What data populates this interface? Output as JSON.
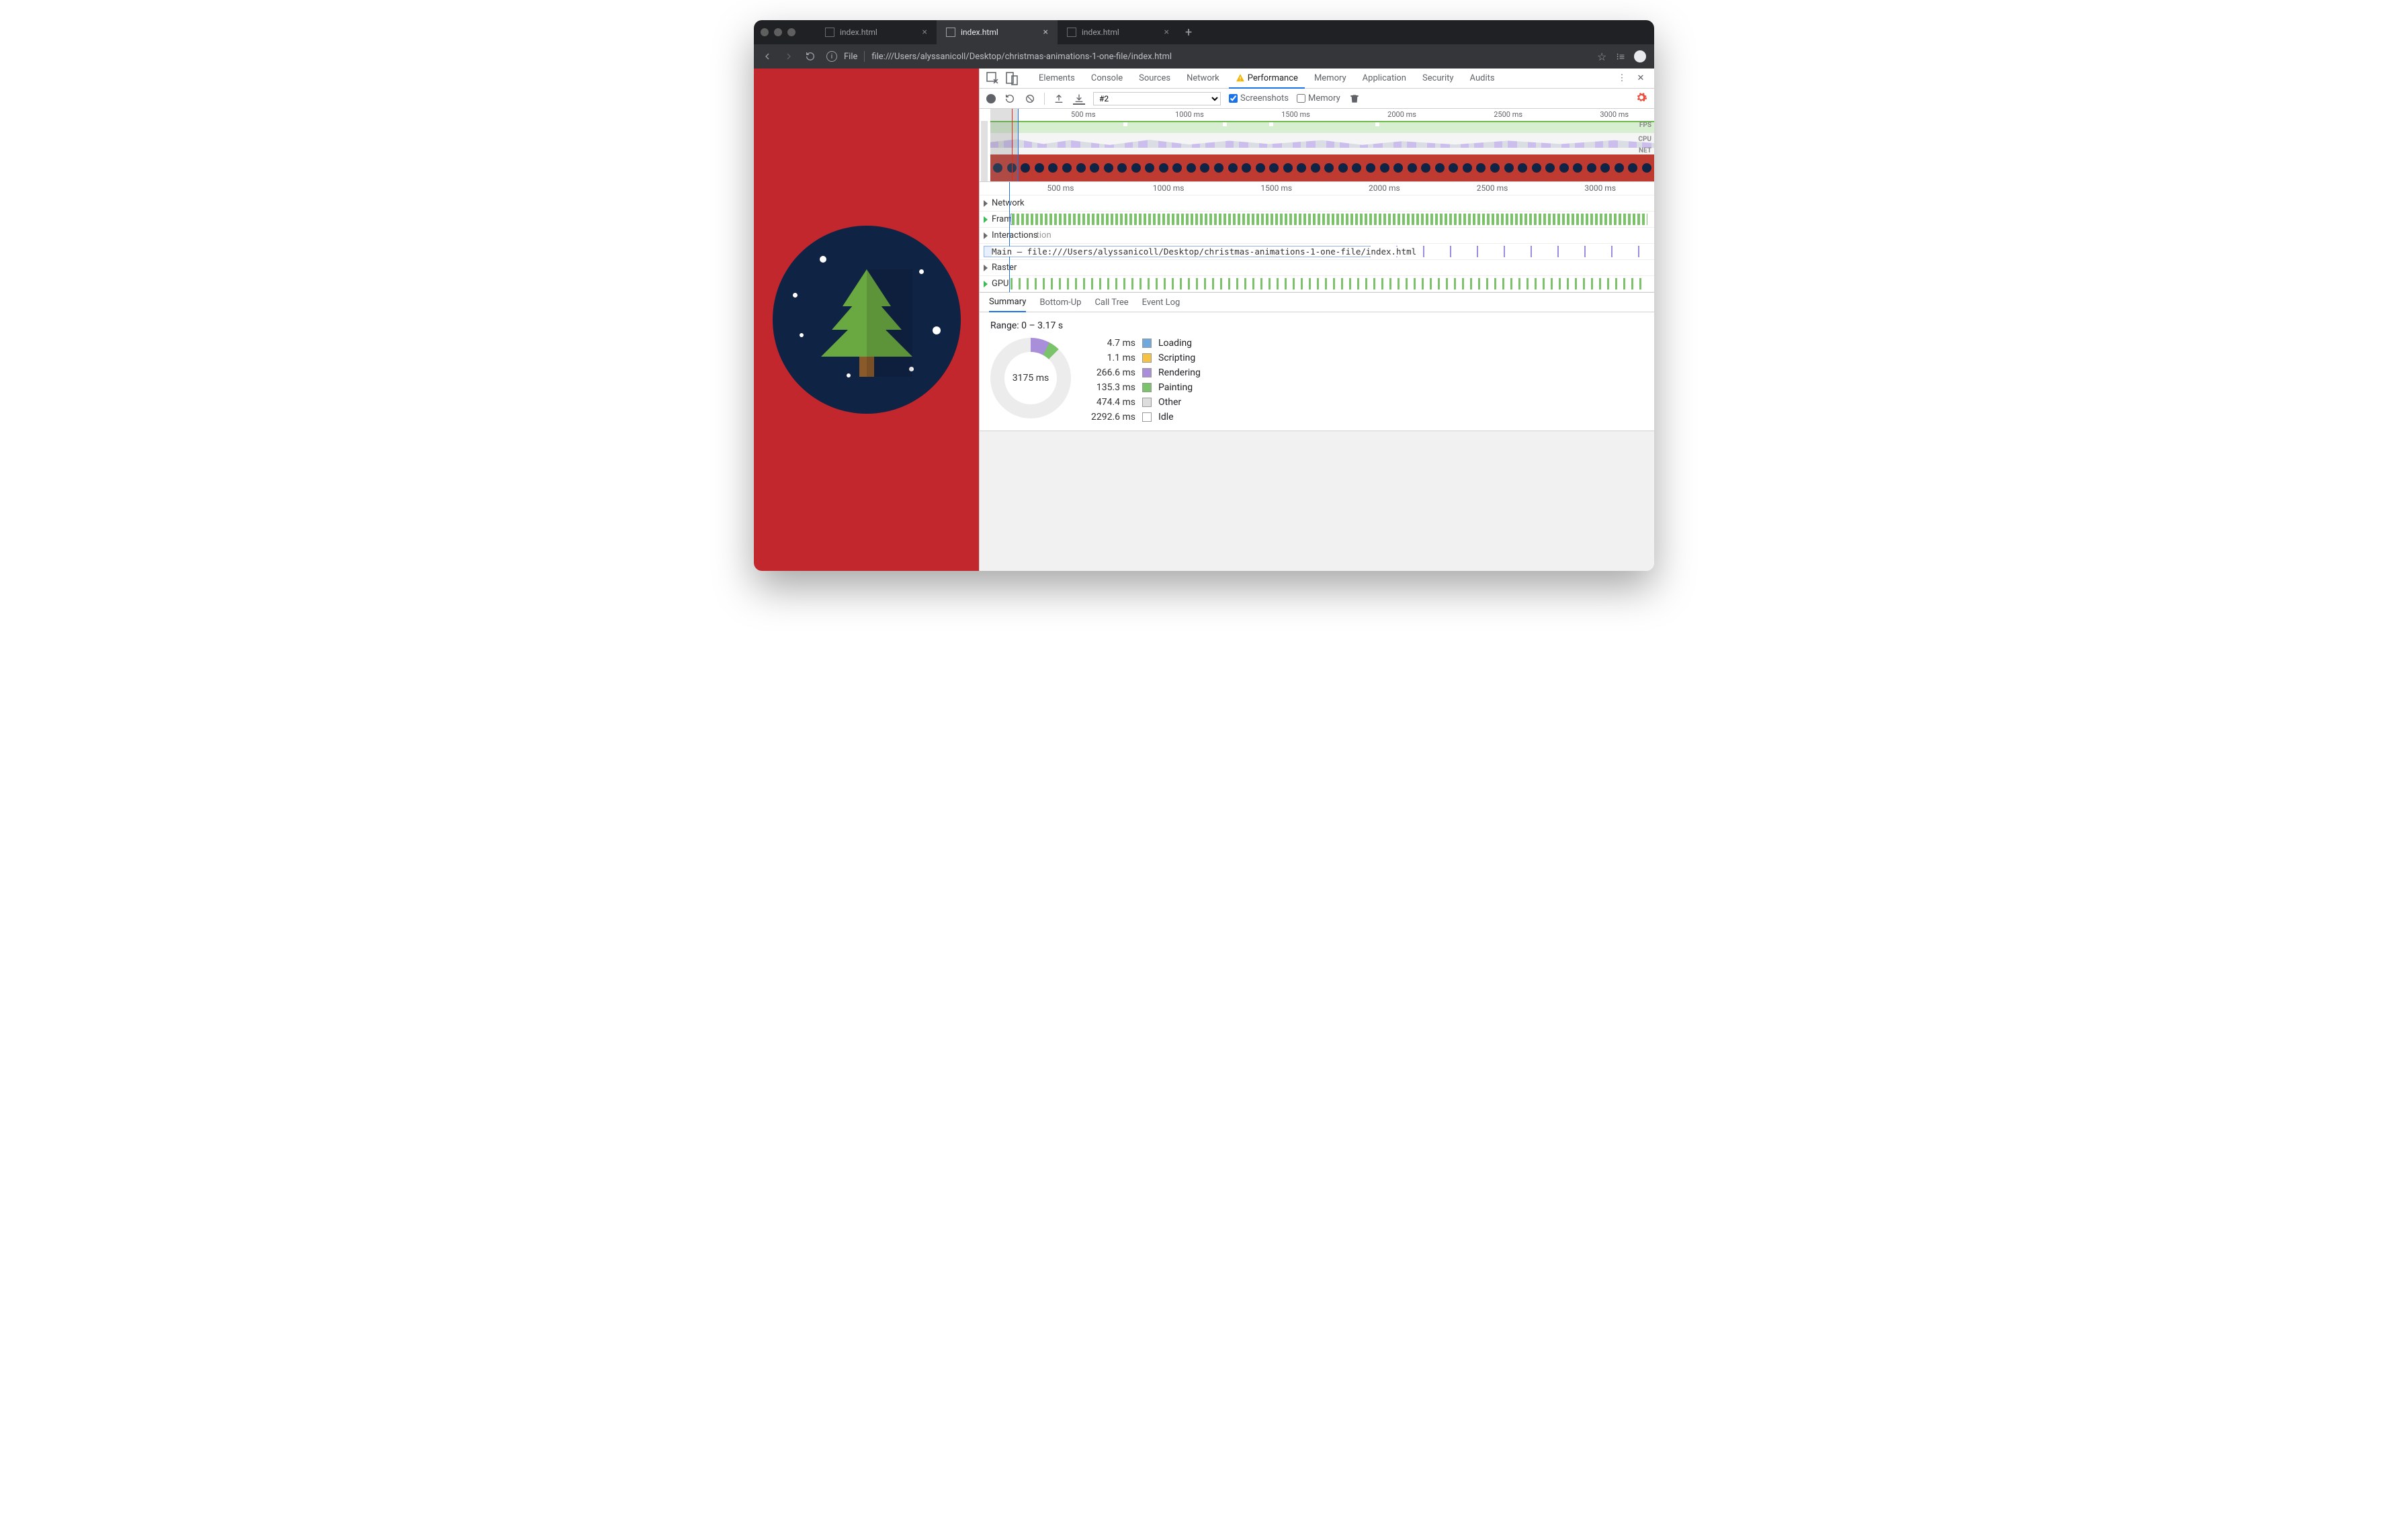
{
  "browser": {
    "tabs": [
      {
        "title": "index.html",
        "active": false
      },
      {
        "title": "index.html",
        "active": true
      },
      {
        "title": "index.html",
        "active": false
      }
    ],
    "address_prefix": "File",
    "url": "file:///Users/alyssanicoll/Desktop/christmas-animations-1-one-file/index.html"
  },
  "devtools": {
    "panels": [
      "Elements",
      "Console",
      "Sources",
      "Network",
      "Performance",
      "Memory",
      "Application",
      "Security",
      "Audits"
    ],
    "active_panel": "Performance",
    "toolbar": {
      "profile_select": "#2",
      "screenshots_label": "Screenshots",
      "memory_label": "Memory",
      "screenshots_checked": true,
      "memory_checked": false
    },
    "overview": {
      "ticks": [
        "500 ms",
        "1000 ms",
        "1500 ms",
        "2000 ms",
        "2500 ms",
        "3000 ms"
      ],
      "labels": {
        "fps": "FPS",
        "cpu": "CPU",
        "net": "NET"
      }
    },
    "flamechart": {
      "ticks": [
        "500 ms",
        "1000 ms",
        "1500 ms",
        "2000 ms",
        "2500 ms",
        "3000 ms"
      ],
      "tracks": {
        "network": "Network",
        "frames": "Frames",
        "interactions": "Interactions",
        "main": "Main — file:///Users/alyssanicoll/Desktop/christmas-animations-1-one-file/index.html",
        "raster": "Raster",
        "gpu": "GPU"
      },
      "interactions_suffix": "tion"
    },
    "bottom_tabs": [
      "Summary",
      "Bottom-Up",
      "Call Tree",
      "Event Log"
    ],
    "active_bottom_tab": "Summary",
    "summary": {
      "range_label": "Range: 0 – 3.17 s",
      "center": "3175 ms",
      "items": [
        {
          "ms": "4.7 ms",
          "label": "Loading",
          "color": "#6fa8dc"
        },
        {
          "ms": "1.1 ms",
          "label": "Scripting",
          "color": "#f6c244"
        },
        {
          "ms": "266.6 ms",
          "label": "Rendering",
          "color": "#a98fd9"
        },
        {
          "ms": "135.3 ms",
          "label": "Painting",
          "color": "#7ac36a"
        },
        {
          "ms": "474.4 ms",
          "label": "Other",
          "color": "#dddddd"
        },
        {
          "ms": "2292.6 ms",
          "label": "Idle",
          "color": "#ffffff"
        }
      ]
    }
  },
  "chart_data": {
    "type": "pie",
    "title": "Range: 0 – 3.17 s",
    "total_ms": 3175,
    "series": [
      {
        "name": "Loading",
        "value": 4.7,
        "color": "#6fa8dc"
      },
      {
        "name": "Scripting",
        "value": 1.1,
        "color": "#f6c244"
      },
      {
        "name": "Rendering",
        "value": 266.6,
        "color": "#a98fd9"
      },
      {
        "name": "Painting",
        "value": 135.3,
        "color": "#7ac36a"
      },
      {
        "name": "Other",
        "value": 474.4,
        "color": "#dddddd"
      },
      {
        "name": "Idle",
        "value": 2292.6,
        "color": "#ffffff"
      }
    ]
  }
}
